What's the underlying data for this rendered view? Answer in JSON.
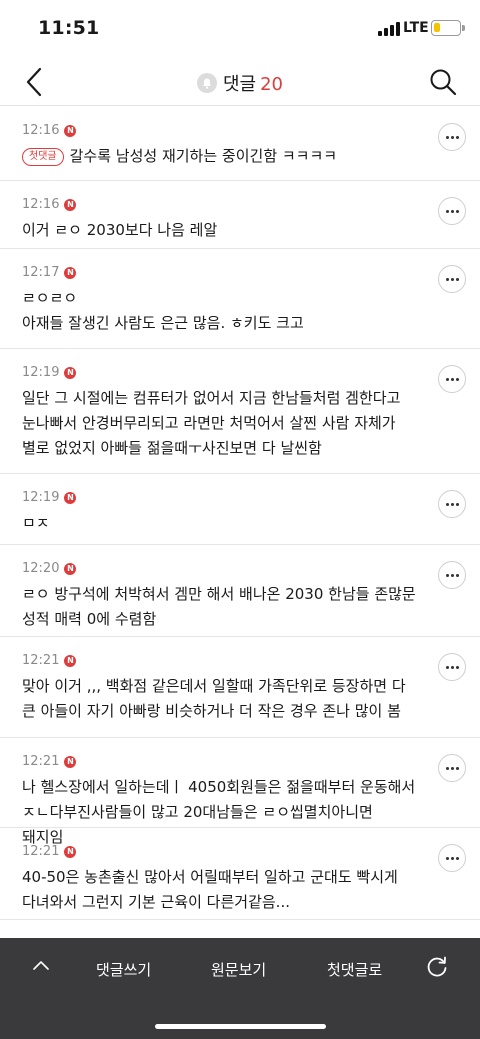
{
  "status_bar": {
    "time": "11:51",
    "network": "LTE",
    "battery_level": 0.25,
    "battery_color": "#f2c500"
  },
  "header": {
    "title": "댓글",
    "count": "20",
    "count_color": "#e03b3b"
  },
  "first_comment_tag": "첫댓글",
  "comments": [
    {
      "time": "12:16",
      "new": "N",
      "text": "갈수록 남성성 재기하는 중이긴함 ㅋㅋㅋㅋ",
      "is_first": true
    },
    {
      "time": "12:16",
      "new": "N",
      "text": "이거 ㄹㅇ 2030보다 나음 레알"
    },
    {
      "time": "12:17",
      "new": "N",
      "text": "ㄹㅇㄹㅇ\n아재들 잘생긴 사람도 은근 많음. ㅎ키도 크고"
    },
    {
      "time": "12:19",
      "new": "N",
      "text": "일단 그 시절에는 컴퓨터가 없어서 지금 한남들처럼 겜한다고 눈나빠서 안경버무리되고 라면만 처먹어서 살찐 사람 자체가 별로 없었지 아빠들 젊을때ㅜ사진보면 다 날씬함"
    },
    {
      "time": "12:19",
      "new": "N",
      "text": "ㅁㅈ"
    },
    {
      "time": "12:20",
      "new": "N",
      "text": "ㄹㅇ 방구석에 처박혀서 겜만 해서 배나온 2030 한남들 존많문 성적 매력 0에 수렴함"
    },
    {
      "time": "12:21",
      "new": "N",
      "text": "맞아 이거 ,,, 백화점 같은데서 일할때 가족단위로 등장하면 다 큰 아들이 자기 아빠랑 비슷하거나 더 작은 경우 존나 많이 봄"
    },
    {
      "time": "12:21",
      "new": "N",
      "text": "나 헬스장에서 일하는데ㅣ 4050회원들은 젊을때부터 운동해서 ㅈㄴ다부진사람들이 많고 20대남들은 ㄹㅇ씹멸치아니면 돼지임"
    },
    {
      "time": "12:21",
      "new": "N",
      "text": "40-50은 농촌출신 많아서 어릴때부터 일하고 군대도 빡시게 다녀와서 그런지 기본 근육이 다른거같음..."
    }
  ],
  "bottom_bar": {
    "write": "댓글쓰기",
    "view_original": "원문보기",
    "to_first": "첫댓글로"
  },
  "icons": [
    "back-icon",
    "bell-icon",
    "search-icon",
    "more-icon",
    "chevron-up-icon",
    "refresh-icon"
  ]
}
